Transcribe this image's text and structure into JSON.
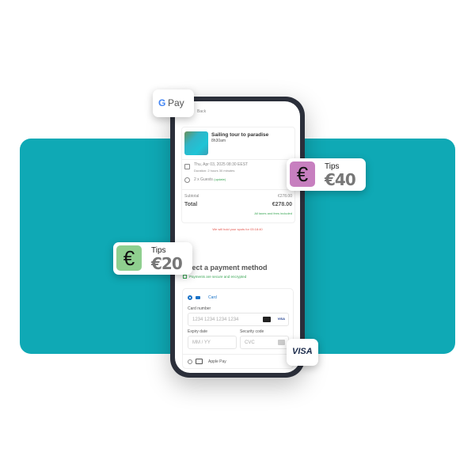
{
  "colors": {
    "band": "#0fa9b5",
    "tips_purple": "#c77fbf",
    "tips_green": "#8fcf8f",
    "secure_green": "#3aa655",
    "hold_red": "#e4564e"
  },
  "screen": {
    "back": "Back",
    "tour": {
      "title": "Sailing tour to paradise",
      "duration": "8h30am"
    },
    "date": "Thu, Apr 03, 2025 08:30 EEST",
    "duration": "Duration: 2 hours 30 minutes",
    "guests": "2 x Guests",
    "guests_update": "(update)",
    "subtotal_label": "Subtotal",
    "subtotal_value": "€278.00",
    "total_label": "Total",
    "total_value": "€278.00",
    "taxes": "All taxes and fees included",
    "hold": "We will hold your spots for 03:18:40",
    "payment_title": "Select a payment method",
    "secure": "Payments are secure and encrypted",
    "card_label": "Card",
    "card_number_label": "Card number",
    "card_number_placeholder": "1234 1234 1234 1234",
    "expiry_label": "Expiry date",
    "expiry_placeholder": "MM / YY",
    "cvc_label": "Security code",
    "cvc_placeholder": "CVC",
    "apple_pay": "Apple Pay"
  },
  "gpay": {
    "g": "G",
    "label": "Pay"
  },
  "tips1": {
    "symbol": "€",
    "label": "Tips",
    "value": "€40"
  },
  "tips2": {
    "symbol": "€",
    "label": "Tips",
    "value": "€20"
  },
  "visa": "VISA"
}
